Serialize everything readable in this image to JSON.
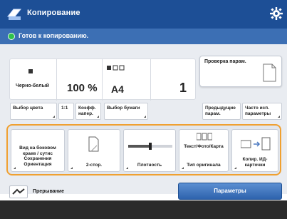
{
  "header": {
    "title": "Копирование",
    "app_icon": "copy-app-icon",
    "settings_icon": "gear-icon"
  },
  "status": {
    "text": "Готов к копированию.",
    "indicator_color": "#2ec24a"
  },
  "current_settings": {
    "color_mode": "Черно-белый",
    "zoom": "100 %",
    "paper": "A4",
    "copies": "1"
  },
  "setting_buttons": {
    "color_select": "Выбор цвета",
    "ratio_label": "1:1",
    "coef_label": "Коэфф. напер.",
    "paper_select": "Выбор бумаги"
  },
  "right_panel": {
    "check_settings": "Проверка парам.",
    "prev_settings": "Предыдущие парам.",
    "frequent": "Часто исп. параметры"
  },
  "function_buttons": [
    {
      "label": "Вид на боковом краев / сутис Сохранения Ориентация",
      "icon": "book-icon"
    },
    {
      "label": "2-стор.",
      "icon": "duplex-icon"
    },
    {
      "label": "Плотность",
      "icon": "density-icon"
    },
    {
      "label": "Тип оригинала",
      "icon": "original-type-icon",
      "top_label": "Текст/Фото/Карта"
    },
    {
      "label": "Копир. ИД-карточки",
      "icon": "id-card-icon"
    }
  ],
  "bottom": {
    "left_label": "Прерывание",
    "params_button": "Параметры"
  },
  "colors": {
    "header_bg": "#1d4f96",
    "status_bg": "#3c6fb4",
    "accent_border": "#f0a030"
  }
}
